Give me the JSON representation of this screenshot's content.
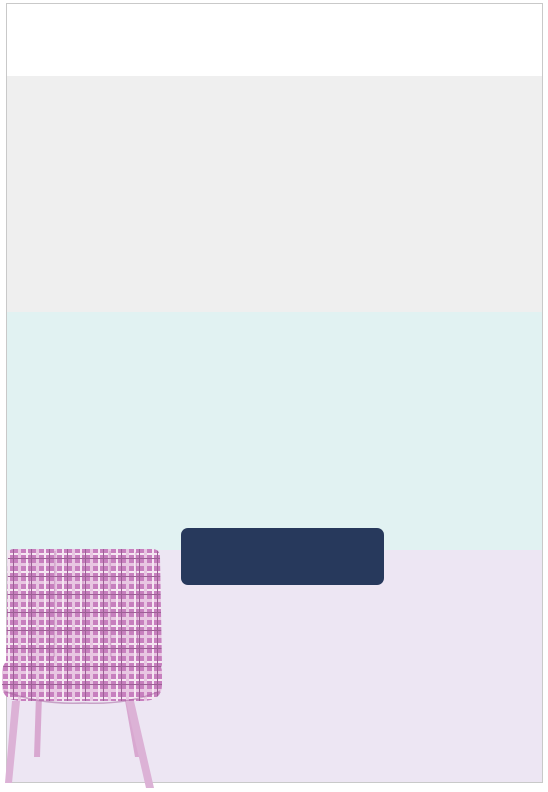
{
  "page": {
    "bands": [
      "white",
      "light-gray",
      "mint",
      "lavender"
    ]
  },
  "cta": {
    "label": "",
    "color": "#27395c"
  },
  "chair": {
    "pattern": "pink plaid",
    "color": "#c77fbe",
    "leg_color": "#d8a8d0"
  },
  "colors": {
    "gray_band": "#efefef",
    "mint_band": "#e1f2f2",
    "lavender_band": "#ede6f3"
  }
}
